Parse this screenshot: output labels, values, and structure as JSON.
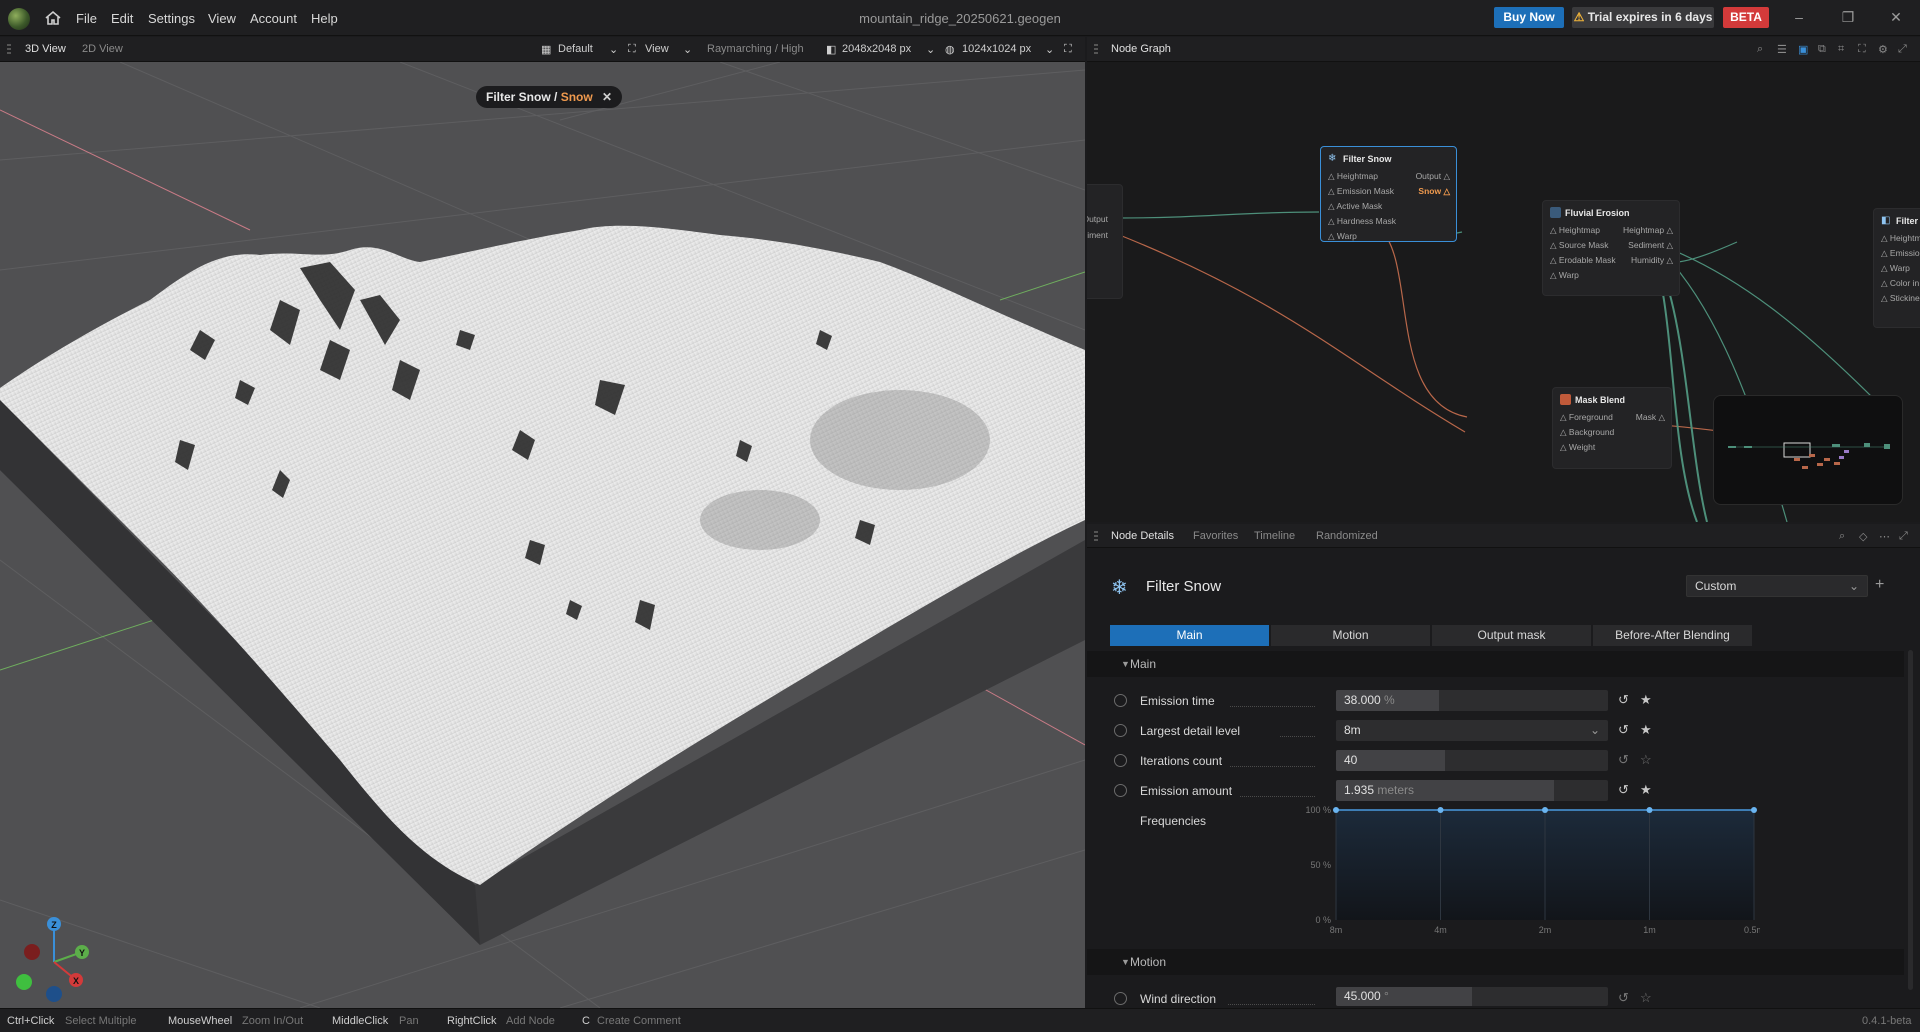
{
  "title": {
    "menus": [
      "File",
      "Edit",
      "Settings",
      "View",
      "Account",
      "Help"
    ],
    "filename": "mountain_ridge_20250621.geogen",
    "buy_now": "Buy Now",
    "trial": "Trial expires in 6 days",
    "beta": "BETA",
    "icons": [
      "home-icon",
      "minimize-icon",
      "maximize-icon",
      "close-icon",
      "warning-icon"
    ]
  },
  "viewport": {
    "tabs": [
      "3D View",
      "2D View"
    ],
    "preset": "Default",
    "view": "View",
    "render": "Raymarching / High",
    "resolution": "2048x2048 px",
    "preview_res": "1024x1024 px",
    "breadcrumb": {
      "node": "Filter Snow",
      "sep": " / ",
      "port": "Snow"
    },
    "gizmo": {
      "z": "Z",
      "y": "Y",
      "x": "X"
    }
  },
  "node_graph": {
    "tab": "Node Graph",
    "nodes": [
      {
        "title": "Filter Snow",
        "inputs": [
          "Heightmap",
          "Emission Mask",
          "Active Mask",
          "Hardness Mask",
          "Warp"
        ],
        "outputs": [
          "Output",
          "Snow"
        ]
      },
      {
        "title": "Fluvial Erosion",
        "inputs": [
          "Heightmap",
          "Source Mask",
          "Erodable Mask",
          "Warp"
        ],
        "outputs": [
          "Heightmap",
          "Sediment",
          "Humidity"
        ]
      },
      {
        "title": "Mask Blend",
        "inputs": [
          "Foreground",
          "Background",
          "Weight"
        ],
        "outputs": [
          "Mask"
        ]
      },
      {
        "title": "Filter C",
        "inputs": [
          "Heightm",
          "Emissio",
          "Warp",
          "Color in",
          "Stickine"
        ],
        "outputs": []
      }
    ],
    "left_node_outputs": [
      "Output",
      "ediment"
    ]
  },
  "details": {
    "tabs": [
      "Node Details",
      "Favorites",
      "Timeline",
      "Randomized"
    ],
    "node_title": "Filter Snow",
    "preset": "Custom",
    "param_tabs": [
      "Main",
      "Motion",
      "Output mask",
      "Before-After Blending"
    ],
    "sections": [
      "Main",
      "Motion"
    ],
    "params": [
      {
        "label": "Emission time",
        "value": "38.000",
        "unit": "%",
        "fill": 0.38,
        "fav": true
      },
      {
        "label": "Largest detail level",
        "value": "8m",
        "unit": "",
        "dropdown": true,
        "fav": true
      },
      {
        "label": "Iterations count",
        "value": "40",
        "unit": "",
        "fill": 0.4,
        "fav": false
      },
      {
        "label": "Emission amount",
        "value": "1.935",
        "unit": "meters",
        "fill": 0.8,
        "fav": true
      }
    ],
    "frequencies": {
      "label": "Frequencies",
      "y_ticks": [
        "100 %",
        "50 %",
        "0 %"
      ],
      "x_ticks": [
        "8m",
        "4m",
        "2m",
        "1m",
        "0.5m"
      ],
      "values": [
        1.0,
        1.0,
        1.0,
        1.0,
        1.0
      ]
    },
    "motion_params": [
      {
        "label": "Wind direction",
        "value": "45.000",
        "unit": "°",
        "fill": 0.5,
        "fav": false
      }
    ]
  },
  "status": {
    "hints": [
      {
        "key": "Ctrl+Click",
        "desc": "Select Multiple"
      },
      {
        "key": "MouseWheel",
        "desc": "Zoom In/Out"
      },
      {
        "key": "MiddleClick",
        "desc": "Pan"
      },
      {
        "key": "RightClick",
        "desc": "Add Node"
      },
      {
        "key": "C",
        "desc": "Create Comment"
      }
    ],
    "version": "0.4.1-beta"
  }
}
